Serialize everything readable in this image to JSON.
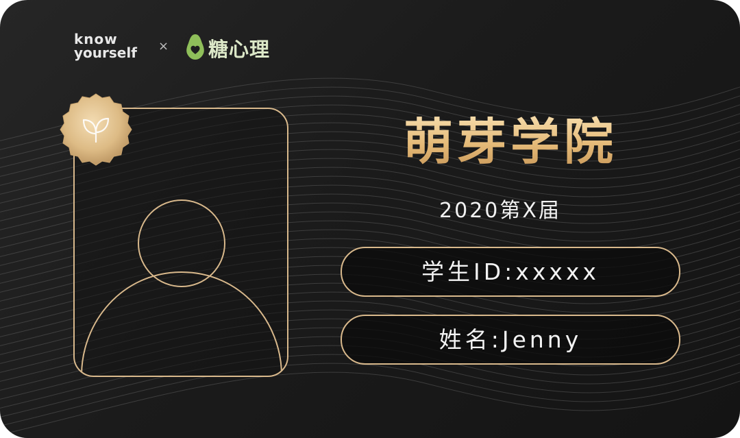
{
  "logos": {
    "knowyourself_line1": "know",
    "knowyourself_line2": "yourself",
    "separator": "×",
    "partner": "糖心理",
    "partner_icon": "avocado-heart-icon"
  },
  "card": {
    "school_name": "萌芽学院",
    "class_year": "2020第X届",
    "student_id": "学生ID:xxxxx",
    "student_name": "姓名:Jenny",
    "seal_icon": "leaf-sprout-icon",
    "photo_placeholder_icon": "person-silhouette-icon"
  },
  "colors": {
    "background": "#1c1c1c",
    "gold": "#d9b98c",
    "gold_text": "#e4b977",
    "partner_green": "#8fbf5a",
    "text": "#f2f2f2"
  }
}
